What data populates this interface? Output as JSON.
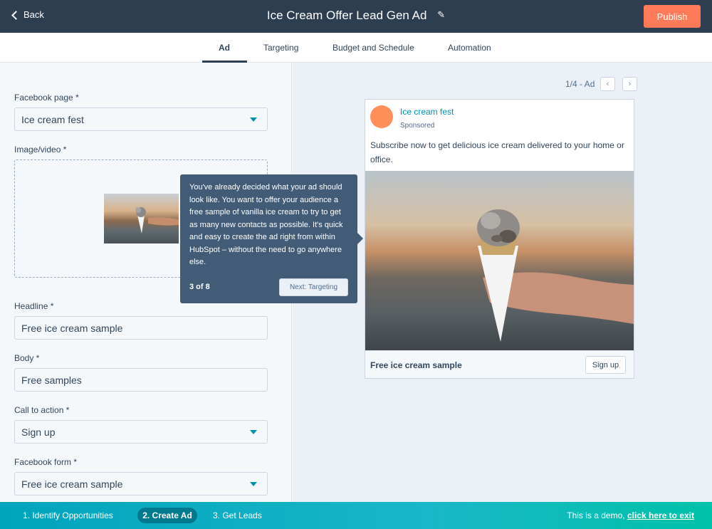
{
  "header": {
    "back_label": "Back",
    "title": "Ice Cream Offer Lead Gen Ad",
    "publish_label": "Publish"
  },
  "tabs": [
    {
      "label": "Ad",
      "active": true
    },
    {
      "label": "Targeting",
      "active": false
    },
    {
      "label": "Budget and Schedule",
      "active": false
    },
    {
      "label": "Automation",
      "active": false
    }
  ],
  "form": {
    "facebook_page": {
      "label": "Facebook page *",
      "value": "Ice cream fest"
    },
    "media": {
      "label": "Image/video *"
    },
    "headline": {
      "label": "Headline *",
      "value": "Free ice cream sample"
    },
    "body": {
      "label": "Body *",
      "value": "Free samples"
    },
    "cta": {
      "label": "Call to action *",
      "value": "Sign up"
    },
    "form": {
      "label": "Facebook form *",
      "value": "Free ice cream sample"
    }
  },
  "tooltip": {
    "text": "You've already decided what your ad should look like. You want to offer your audience a free sample of vanilla ice cream to try to get as many new contacts as possible. It's quick and easy to create the ad right from within HubSpot – without the need to go anywhere else.",
    "step": "3 of 8",
    "next_label": "Next: Targeting"
  },
  "preview": {
    "pager": "1/4 - Ad",
    "page_name": "Ice cream fest",
    "sponsored": "Sponsored",
    "body": "Subscribe now to get delicious ice cream delivered to your home or office.",
    "headline": "Free ice cream sample",
    "cta": "Sign up"
  },
  "bottom": {
    "steps": [
      "1. Identify Opportunities",
      "2. Create Ad",
      "3. Get Leads"
    ],
    "demo_text": "This is a demo, ",
    "demo_link": "click here to exit"
  },
  "colors": {
    "header_bg": "#2d3e50",
    "publish": "#ff7a59",
    "accent": "#0091ae",
    "tooltip_bg": "#425b76",
    "bottom_bar": "#00a4bd"
  }
}
